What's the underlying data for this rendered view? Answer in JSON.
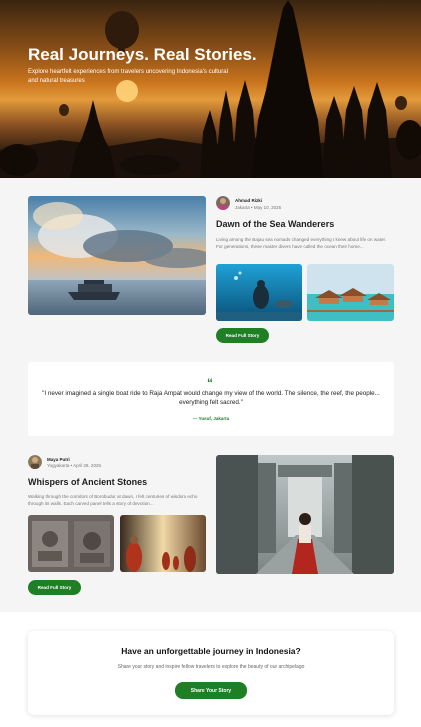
{
  "hero": {
    "title": "Real Journeys. Real Stories.",
    "subtitle": "Explore heartfelt experiences from travelers uncovering Indonesia's cultural and natural treasures"
  },
  "story1": {
    "author_name": "Ahmad Rizki",
    "author_meta": "Jakarta • May 10, 2025",
    "title": "Dawn of the Sea Wanderers",
    "excerpt": "Living among the Bajau sea nomads changed everything I knew about life on water. For generations, these master divers have called the ocean their home...",
    "button": "Read Full Story",
    "images": [
      "boat-at-sunset",
      "freediver-underwater",
      "stilt-water-villas"
    ]
  },
  "quote": {
    "icon": "quote-mark-icon",
    "text": "\"I never imagined a single boat ride to Raja Ampat would change my view of the world. The silence, the reef, the people... everything felt sacred.\"",
    "author": "— Yusuf, Jakarta"
  },
  "story2": {
    "author_name": "Maya Putri",
    "author_meta": "Yogyakarta • April 28, 2025",
    "title": "Whispers of Ancient Stones",
    "excerpt": "Walking through the corridors of Borobudur at dawn, I felt centuries of wisdom echo through its walls. Each carved panel tells a story of devotion...",
    "button": "Read Full Story",
    "images": [
      "temple-relief-carvings",
      "monks-at-temple",
      "woman-at-temple-gate"
    ]
  },
  "cta": {
    "title": "Have an unforgettable journey in Indonesia?",
    "subtitle": "Share your story and inspire fellow travelers to explore the beauty of our archipelago",
    "button": "Share Your Story"
  },
  "colors": {
    "accent": "#1f7f25",
    "background": "#f5f5f5"
  }
}
